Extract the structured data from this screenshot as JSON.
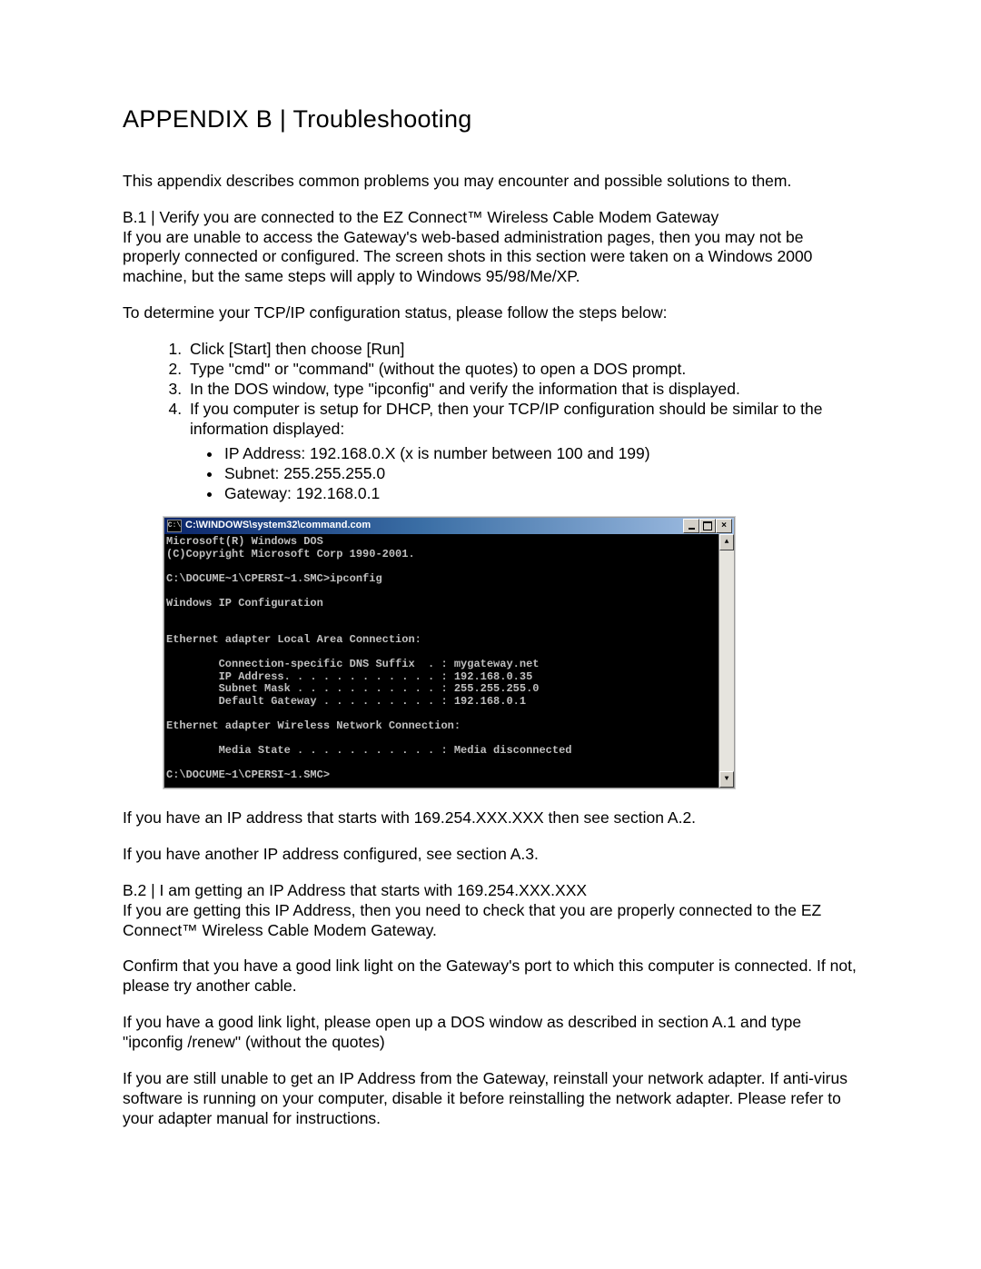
{
  "title": "APPENDIX B |  Troubleshooting",
  "intro": "This appendix describes common problems you may encounter and possible solutions to them.",
  "b1": {
    "head": "B.1 |  Verify you are connected to the EZ Connect™ Wireless Cable Modem Gateway",
    "p1": "If you are unable to access the Gateway's web-based administration pages, then you may not be properly connected or configured. The screen shots in this section were taken on a Windows 2000 machine, but the same steps will apply to Windows 95/98/Me/XP.",
    "p2": "To determine your TCP/IP configuration status, please follow the steps below:",
    "steps": [
      "Click [Start] then choose [Run]",
      "Type \"cmd\" or \"command\" (without the quotes) to open a DOS prompt.",
      "In the DOS window, type \"ipconfig\" and verify the information that is displayed.",
      "If you computer is setup for DHCP, then your TCP/IP configuration should be similar to the information displayed:"
    ],
    "bullets": [
      "IP Address: 192.168.0.X (x is number between 100 and 199)",
      "Subnet: 255.255.255.0",
      "Gateway: 192.168.0.1"
    ]
  },
  "cmd": {
    "title": "C:\\WINDOWS\\system32\\command.com",
    "lines": "Microsoft(R) Windows DOS\n(C)Copyright Microsoft Corp 1990-2001.\n\nC:\\DOCUME~1\\CPERSI~1.SMC>ipconfig\n\nWindows IP Configuration\n\n\nEthernet adapter Local Area Connection:\n\n        Connection-specific DNS Suffix  . : mygateway.net\n        IP Address. . . . . . . . . . . . : 192.168.0.35\n        Subnet Mask . . . . . . . . . . . : 255.255.255.0\n        Default Gateway . . . . . . . . . : 192.168.0.1\n\nEthernet adapter Wireless Network Connection:\n\n        Media State . . . . . . . . . . . : Media disconnected\n\nC:\\DOCUME~1\\CPERSI~1.SMC>"
  },
  "after1": "If you have an IP address that starts with 169.254.XXX.XXX then see section A.2.",
  "after2": "If you have another IP address configured, see section A.3.",
  "b2": {
    "head": "B.2 |  I am getting an IP Address that starts with 169.254.XXX.XXX",
    "p1": "If you are getting this IP Address, then you need to check that you are properly connected to the EZ Connect™ Wireless Cable Modem Gateway.",
    "p2": "Confirm that you have a good link light on the Gateway's port to which this computer is connected.  If not, please try another cable.",
    "p3": "If you have a good link light, please open up a DOS window as described in section A.1 and type \"ipconfig /renew\" (without the quotes)",
    "p4": "If you are still unable to get an IP Address from the Gateway, reinstall your network adapter. If anti-virus software is running on your computer, disable it before reinstalling the network adapter.  Please refer to your adapter manual for instructions."
  }
}
